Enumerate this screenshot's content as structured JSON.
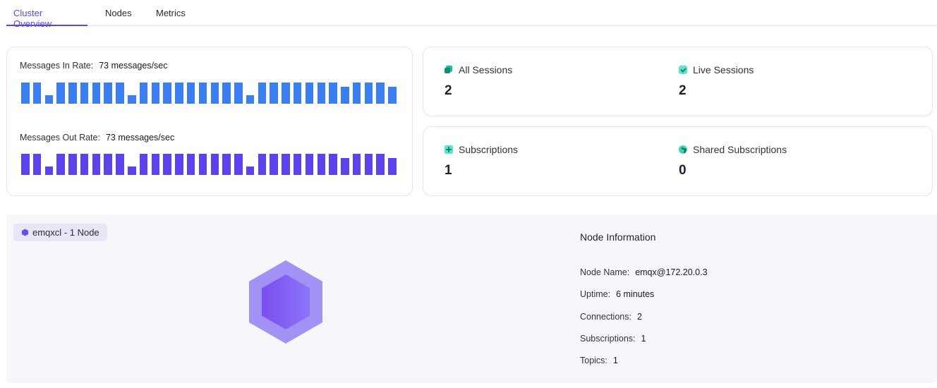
{
  "tabs": [
    {
      "label": "Cluster Overview",
      "active": true
    },
    {
      "label": "Nodes",
      "active": false
    },
    {
      "label": "Metrics",
      "active": false
    }
  ],
  "rates": {
    "in_label": "Messages In Rate:",
    "in_value": "73 messages/sec",
    "out_label": "Messages Out Rate:",
    "out_value": "73 messages/sec",
    "in_color": "#3a7ef6",
    "out_color": "#5b43f0",
    "in_bars": [
      1,
      1,
      0.4,
      1,
      1,
      1,
      1,
      1,
      1,
      0.4,
      1,
      1,
      1,
      1,
      1,
      1,
      1,
      1,
      1,
      0.4,
      1,
      1,
      1,
      1,
      1,
      1,
      1,
      0.8,
      1,
      1,
      1,
      0.8
    ],
    "out_bars": [
      1,
      1,
      0.4,
      1,
      1,
      1,
      1,
      1,
      1,
      0.4,
      1,
      1,
      1,
      1,
      1,
      1,
      1,
      1,
      1,
      0.4,
      1,
      1,
      1,
      1,
      1,
      1,
      1,
      0.8,
      1,
      1,
      1,
      0.8
    ]
  },
  "stats": {
    "all_sessions": {
      "label": "All Sessions",
      "value": "2",
      "icon": "sessions-icon"
    },
    "live_sessions": {
      "label": "Live Sessions",
      "value": "2",
      "icon": "live-sessions-icon"
    },
    "subscriptions": {
      "label": "Subscriptions",
      "value": "1",
      "icon": "subscriptions-icon"
    },
    "shared_subscriptions": {
      "label": "Shared Subscriptions",
      "value": "0",
      "icon": "shared-subscriptions-icon"
    }
  },
  "cluster": {
    "tag": "emqxcl - 1 Node",
    "accent": "#6c4df5"
  },
  "node_info": {
    "title": "Node Information",
    "node_name_label": "Node Name:",
    "node_name": "emqx@172.20.0.3",
    "uptime_label": "Uptime:",
    "uptime": "6 minutes",
    "connections_label": "Connections:",
    "connections": "2",
    "subscriptions_label": "Subscriptions:",
    "subscriptions": "1",
    "topics_label": "Topics:",
    "topics": "1"
  }
}
